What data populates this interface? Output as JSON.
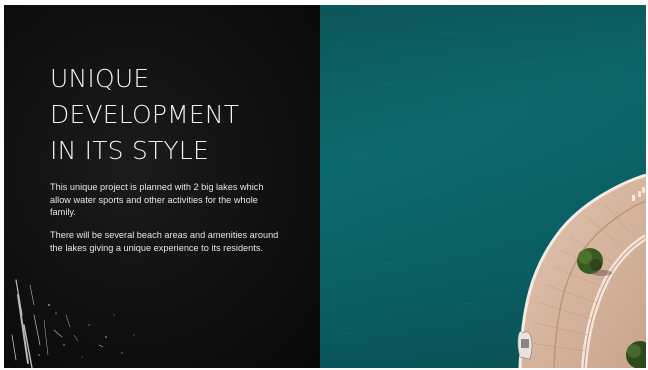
{
  "slide": {
    "title_lines": [
      "UNIQUE",
      "DEVELOPMENT",
      "IN ITS STYLE"
    ],
    "paragraphs": [
      "This unique project is planned with 2 big lakes which allow water sports and other activities for the whole family.",
      "There will be several beach areas and amenities around the lakes giving a unique experience to its residents."
    ]
  },
  "colors": {
    "left_background": "#111111",
    "water": "#0c6a6d",
    "deck": "#d9b9a3",
    "tree": "#2f4a1e",
    "text": "#f2f2f2"
  },
  "image": {
    "description_icon": "aerial-lake-photo-icon"
  }
}
